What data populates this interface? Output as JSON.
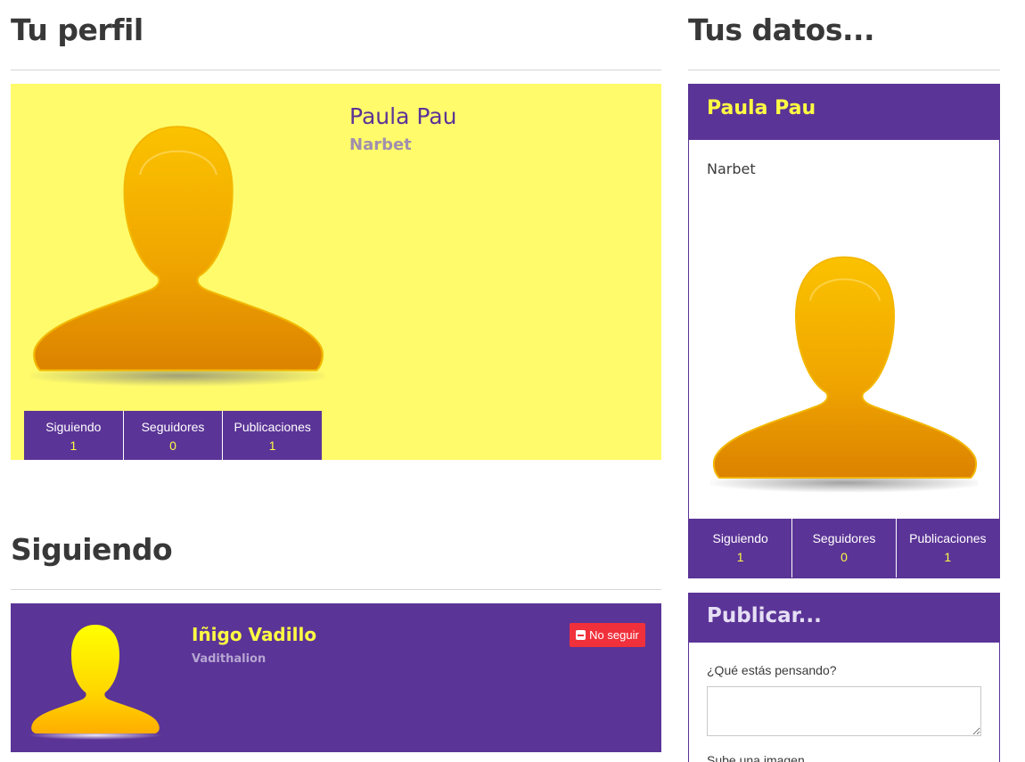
{
  "profile": {
    "section_title": "Tu perfil",
    "name": "Paula Pau",
    "nick": "Narbet",
    "stats": [
      {
        "label": "Siguiendo",
        "value": "1"
      },
      {
        "label": "Seguidores",
        "value": "0"
      },
      {
        "label": "Publicaciones",
        "value": "1"
      }
    ]
  },
  "following": {
    "section_title": "Siguiendo",
    "users": [
      {
        "name": "Iñigo Vadillo",
        "nick": "Vadithalion",
        "unfollow_label": "No seguir"
      }
    ]
  },
  "data_panel": {
    "section_title": "Tus datos...",
    "name": "Paula Pau",
    "nick": "Narbet",
    "stats": [
      {
        "label": "Siguiendo",
        "value": "1"
      },
      {
        "label": "Seguidores",
        "value": "0"
      },
      {
        "label": "Publicaciones",
        "value": "1"
      }
    ]
  },
  "publish": {
    "title": "Publicar...",
    "text_label": "¿Qué estás pensando?",
    "text_value": "",
    "upload_label": "Sube una imagen"
  },
  "colors": {
    "brand_purple": "#5b3497",
    "highlight_yellow": "#fffb43",
    "card_yellow": "#fffb6b",
    "danger_red": "#f0303b"
  },
  "icons": [
    "user-avatar-icon",
    "minus-square-icon"
  ]
}
